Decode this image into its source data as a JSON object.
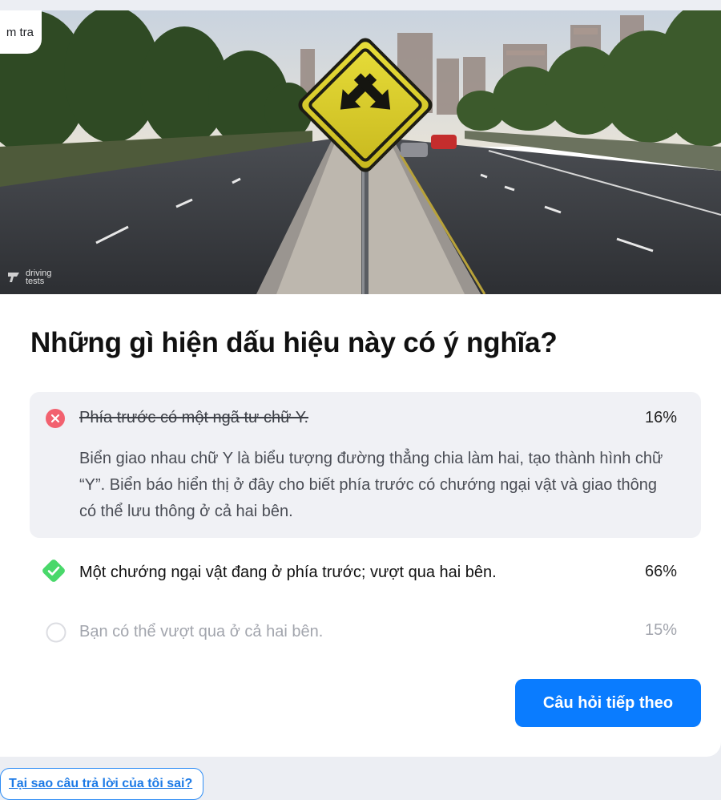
{
  "hero": {
    "tag_label": "m tra",
    "watermark": {
      "line1": "driving",
      "line2": "tests"
    },
    "image_alt": "Yellow diamond road sign with two diagonal arrows pointing down-left and down-right on a median between road lanes, city skyline in the background"
  },
  "question": {
    "title": "Những gì hiện dấu hiệu này có ý nghĩa?"
  },
  "answers": [
    {
      "text": "Phía trước có một ngã tư chữ Y.",
      "percent": "16%",
      "state": "wrong",
      "icon": "wrong-x-icon",
      "explanation": "Biển giao nhau chữ Y là biểu tượng đường thẳng chia làm hai, tạo thành hình chữ “Y”. Biển báo hiển thị ở đây cho biết phía trước có chướng ngại vật và giao thông có thể lưu thông ở cả hai bên."
    },
    {
      "text": "Một chướng ngại vật đang ở phía trước; vượt qua hai bên.",
      "percent": "66%",
      "state": "correct",
      "icon": "correct-check-icon"
    },
    {
      "text": "Bạn có thể vượt qua ở cả hai bên.",
      "percent": "15%",
      "state": "neutral",
      "icon": "empty-circle-icon"
    }
  ],
  "actions": {
    "next_label": "Câu hỏi tiếp theo",
    "why_label": "Tại sao câu trả lời của tôi sai?"
  },
  "colors": {
    "primary": "#0a7cff",
    "wrong": "#f2616f",
    "correct": "#49d86a",
    "answer_bg": "#f0f1f5"
  }
}
